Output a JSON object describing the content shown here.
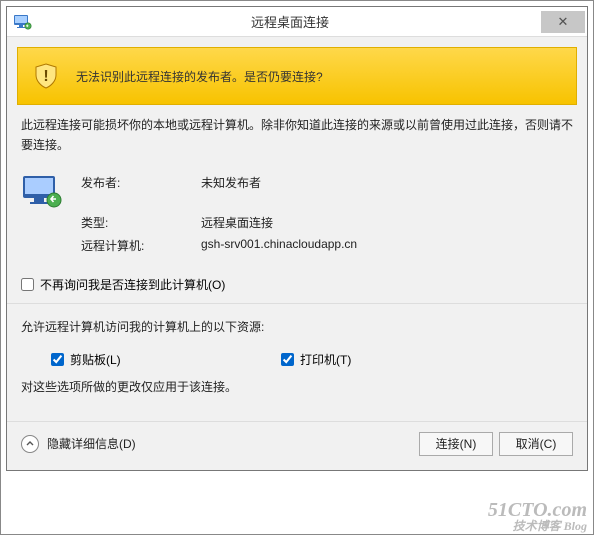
{
  "titlebar": {
    "title": "远程桌面连接",
    "close_label": "✕",
    "icon_name": "rdp-icon"
  },
  "banner": {
    "message": "无法识别此远程连接的发布者。是否仍要连接?"
  },
  "body": {
    "paragraph": "此远程连接可能损坏你的本地或远程计算机。除非你知道此连接的来源或以前曾使用过此连接，否则请不要连接。",
    "publisher_label": "发布者:",
    "publisher_value": "未知发布者",
    "type_label": "类型:",
    "type_value": "远程桌面连接",
    "remote_label": "远程计算机:",
    "remote_value": "gsh-srv001.chinacloudapp.cn",
    "dont_ask": "不再询问我是否连接到此计算机(O)",
    "allow_title": "允许远程计算机访问我的计算机上的以下资源:",
    "clipboard": "剪贴板(L)",
    "printer": "打印机(T)",
    "note": "对这些选项所做的更改仅应用于该连接。"
  },
  "footer": {
    "hide_details": "隐藏详细信息(D)",
    "connect": "连接(N)",
    "cancel": "取消(C)"
  },
  "checkboxes": {
    "dont_ask": false,
    "clipboard": true,
    "printer": true
  },
  "watermark": {
    "main": "51CTO.com",
    "sub": "技术博客  Blog"
  }
}
